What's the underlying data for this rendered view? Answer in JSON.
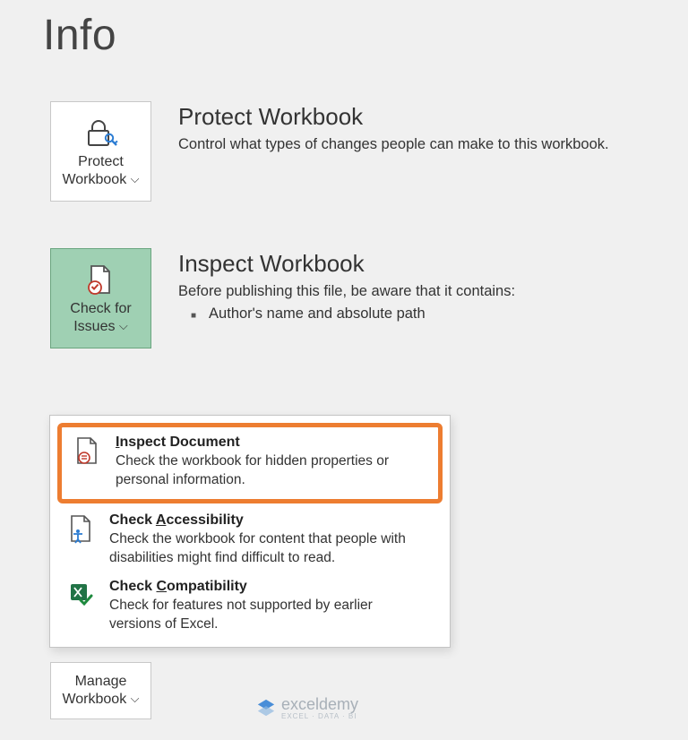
{
  "page": {
    "title": "Info"
  },
  "sections": {
    "protect": {
      "tile_label": "Protect Workbook",
      "heading": "Protect Workbook",
      "desc": "Control what types of changes people can make to this workbook."
    },
    "inspect": {
      "tile_label": "Check for Issues",
      "heading": "Inspect Workbook",
      "desc": "Before publishing this file, be aware that it contains:",
      "bullets": [
        "Author's name and absolute path"
      ]
    },
    "manage": {
      "tile_label": "Manage Workbook"
    }
  },
  "dropdown": {
    "items": [
      {
        "title_pre": "",
        "title_ul": "I",
        "title_post": "nspect Document",
        "desc": "Check the workbook for hidden properties or personal information."
      },
      {
        "title_pre": "Check ",
        "title_ul": "A",
        "title_post": "ccessibility",
        "desc": "Check the workbook for content that people with disabilities might find difficult to read."
      },
      {
        "title_pre": "Check ",
        "title_ul": "C",
        "title_post": "ompatibility",
        "desc": "Check for features not supported by earlier versions of Excel."
      }
    ]
  },
  "watermark": {
    "brand": "exceldemy",
    "tagline": "EXCEL · DATA · BI"
  }
}
